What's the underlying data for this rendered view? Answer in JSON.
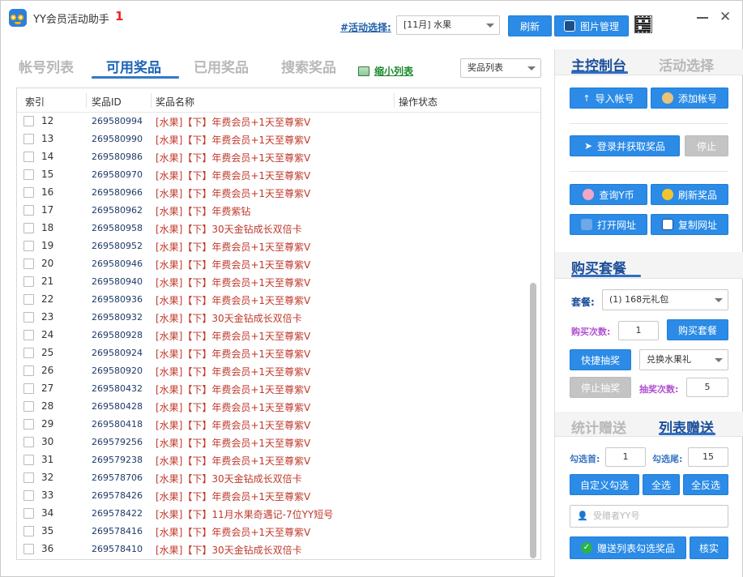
{
  "title_bar": {
    "title": "YY会员活动助手",
    "badge": "1",
    "activity_label": "#活动选择:",
    "activity_selected": "[11月] 水果",
    "refresh_label": "刷新",
    "image_manager_label": "图片管理"
  },
  "left_panel": {
    "tabs": [
      "帐号列表",
      "可用奖品",
      "已用奖品",
      "搜索奖品"
    ],
    "active_tab": "可用奖品",
    "shrink_list_label": "缩小列表",
    "list_type_selected": "奖品列表",
    "columns": [
      "索引",
      "奖品ID",
      "奖品名称",
      "操作状态"
    ],
    "rows": [
      {
        "index": "12",
        "id": "269580994",
        "name": "[水果]【下】年费会员+1天至尊紫V"
      },
      {
        "index": "13",
        "id": "269580990",
        "name": "[水果]【下】年费会员+1天至尊紫V"
      },
      {
        "index": "14",
        "id": "269580986",
        "name": "[水果]【下】年费会员+1天至尊紫V"
      },
      {
        "index": "15",
        "id": "269580970",
        "name": "[水果]【下】年费会员+1天至尊紫V"
      },
      {
        "index": "16",
        "id": "269580966",
        "name": "[水果]【下】年费会员+1天至尊紫V"
      },
      {
        "index": "17",
        "id": "269580962",
        "name": "[水果]【下】年费紫钻"
      },
      {
        "index": "18",
        "id": "269580958",
        "name": "[水果]【下】30天金钻成长双倍卡"
      },
      {
        "index": "19",
        "id": "269580952",
        "name": "[水果]【下】年费会员+1天至尊紫V"
      },
      {
        "index": "20",
        "id": "269580946",
        "name": "[水果]【下】年费会员+1天至尊紫V"
      },
      {
        "index": "21",
        "id": "269580940",
        "name": "[水果]【下】年费会员+1天至尊紫V"
      },
      {
        "index": "22",
        "id": "269580936",
        "name": "[水果]【下】年费会员+1天至尊紫V"
      },
      {
        "index": "23",
        "id": "269580932",
        "name": "[水果]【下】30天金钻成长双倍卡"
      },
      {
        "index": "24",
        "id": "269580928",
        "name": "[水果]【下】年费会员+1天至尊紫V"
      },
      {
        "index": "25",
        "id": "269580924",
        "name": "[水果]【下】年费会员+1天至尊紫V"
      },
      {
        "index": "26",
        "id": "269580920",
        "name": "[水果]【下】年费会员+1天至尊紫V"
      },
      {
        "index": "27",
        "id": "269580432",
        "name": "[水果]【下】年费会员+1天至尊紫V"
      },
      {
        "index": "28",
        "id": "269580428",
        "name": "[水果]【下】年费会员+1天至尊紫V"
      },
      {
        "index": "29",
        "id": "269580418",
        "name": "[水果]【下】年费会员+1天至尊紫V"
      },
      {
        "index": "30",
        "id": "269579256",
        "name": "[水果]【下】年费会员+1天至尊紫V"
      },
      {
        "index": "31",
        "id": "269579238",
        "name": "[水果]【下】年费会员+1天至尊紫V"
      },
      {
        "index": "32",
        "id": "269578706",
        "name": "[水果]【下】30天金钻成长双倍卡"
      },
      {
        "index": "33",
        "id": "269578426",
        "name": "[水果]【下】年费会员+1天至尊紫V"
      },
      {
        "index": "34",
        "id": "269578422",
        "name": "[水果]【下】11月水果奇遇记-7位YY短号"
      },
      {
        "index": "35",
        "id": "269578416",
        "name": "[水果]【下】年费会员+1天至尊紫V"
      },
      {
        "index": "36",
        "id": "269578410",
        "name": "[水果]【下】30天金钻成长双倍卡"
      }
    ]
  },
  "right_panel": {
    "top_tabs": [
      "主控制台",
      "活动选择"
    ],
    "import_account": "导入帐号",
    "add_account": "添加帐号",
    "login_fetch": "登录并获取奖品",
    "stop": "停止",
    "query_y_coin": "查询Y币",
    "refresh_prizes": "刷新奖品",
    "open_url": "打开网址",
    "copy_url": "复制网址",
    "buy_section_title": "购买套餐",
    "package_label": "套餐:",
    "package_selected": "(1) 168元礼包",
    "buy_count_label": "购买次数:",
    "buy_count_value": "1",
    "buy_button": "购买套餐",
    "quick_draw": "快捷抽奖",
    "draw_option_selected": "兑换水果礼",
    "stop_draw": "停止抽奖",
    "draw_count_label": "抽奖次数:",
    "draw_count_value": "5",
    "bottom_tabs": [
      "统计赠送",
      "列表赠送"
    ],
    "select_first_label": "勾选首:",
    "select_first_value": "1",
    "select_last_label": "勾选尾:",
    "select_last_value": "15",
    "custom_select": "自定义勾选",
    "select_all": "全选",
    "invert_select": "全反选",
    "recipient_placeholder": "受赠者YY号",
    "gift_selected": "赠送列表勾选奖品",
    "verify": "核实"
  },
  "colors": {
    "primary_button": "#2b8be6",
    "active_tab": "#1c63b8",
    "prize_name": "#c0392b",
    "purple_label": "#b04fd0"
  }
}
